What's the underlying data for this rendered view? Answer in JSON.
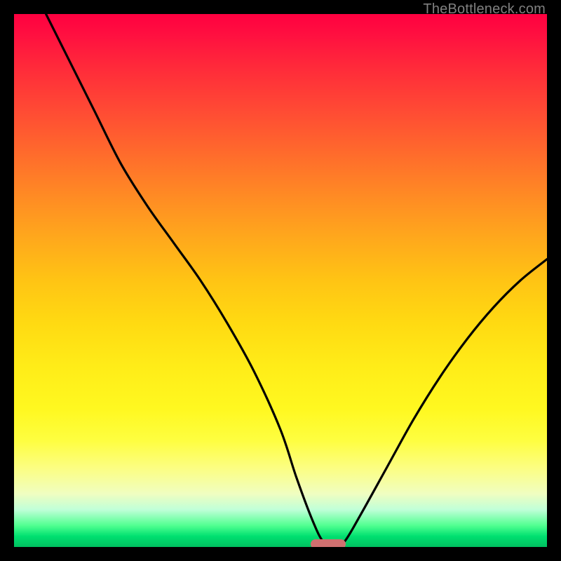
{
  "watermark": "TheBottleneck.com",
  "chart_data": {
    "type": "line",
    "title": "",
    "xlabel": "",
    "ylabel": "",
    "xlim": [
      0,
      100
    ],
    "ylim": [
      0,
      100
    ],
    "background_gradient": {
      "direction": "top-to-bottom",
      "stops": [
        {
          "pos": 0,
          "color": "#ff0040"
        },
        {
          "pos": 50,
          "color": "#ffc414"
        },
        {
          "pos": 80,
          "color": "#fefe40"
        },
        {
          "pos": 96,
          "color": "#50ff90"
        },
        {
          "pos": 100,
          "color": "#00c060"
        }
      ]
    },
    "series": [
      {
        "name": "bottleneck-curve",
        "x": [
          6,
          10,
          15,
          20,
          25,
          30,
          35,
          40,
          45,
          50,
          53,
          56,
          58,
          60,
          62,
          65,
          70,
          75,
          80,
          85,
          90,
          95,
          100
        ],
        "y": [
          100,
          92,
          82,
          72,
          64,
          57,
          50,
          42,
          33,
          22,
          13,
          5,
          1,
          0,
          1,
          6,
          15,
          24,
          32,
          39,
          45,
          50,
          54
        ]
      }
    ],
    "marker": {
      "x": 59,
      "y": 0.5,
      "color": "#d07070",
      "shape": "pill"
    }
  },
  "colors": {
    "curve": "#000000",
    "frame": "#000000"
  }
}
